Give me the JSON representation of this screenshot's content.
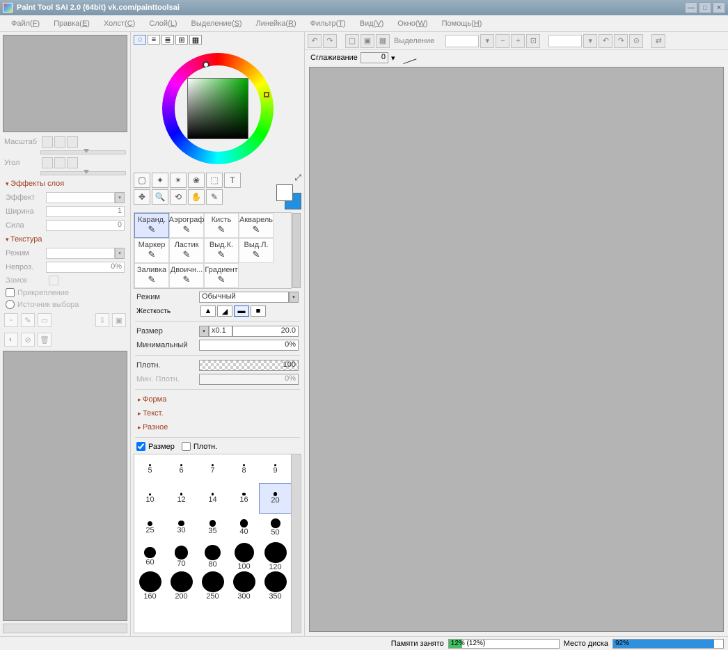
{
  "title": "Paint Tool SAI 2.0 (64bit) vk.com/painttoolsai",
  "menu": [
    "Файл(F)",
    "Правка(E)",
    "Холст(C)",
    "Слой(L)",
    "Выделение(S)",
    "Линейка(R)",
    "Фильтр(T)",
    "Вид(V)",
    "Окно(W)",
    "Помощь(H)"
  ],
  "nav": {
    "scale": "Масштаб",
    "angle": "Угол"
  },
  "layerfx": {
    "head": "Эффекты слоя",
    "effect_label": "Эффект",
    "width_label": "Ширина",
    "width_val": "1",
    "strength_label": "Сила",
    "strength_val": "0"
  },
  "texture": {
    "head": "Текстура",
    "mode_label": "Режим",
    "opacity_label": "Непроз.",
    "opacity_val": "0%",
    "lock_label": "Замок",
    "attach_label": "Прикрепление",
    "source_label": "Источник выбора"
  },
  "tools_icons": [
    "◌",
    "≡",
    "≣",
    "⊞",
    "▦"
  ],
  "sel_tools": [
    "▢",
    "✦",
    "✴",
    "❀",
    "⬚",
    "T",
    "✥",
    "🔍",
    "⟲",
    "✋",
    "✎"
  ],
  "brush_tools": [
    {
      "name": "Каранд.",
      "sel": true
    },
    {
      "name": "Аэрограф"
    },
    {
      "name": "Кисть"
    },
    {
      "name": "Акварель"
    },
    {
      "name": "Маркер"
    },
    {
      "name": "Ластик"
    },
    {
      "name": "Выд.К."
    },
    {
      "name": "Выд.Л."
    },
    {
      "name": "Заливка"
    },
    {
      "name": "Двоичн..."
    },
    {
      "name": "Градиент"
    }
  ],
  "brush": {
    "mode_label": "Режим",
    "mode_val": "Обычный",
    "hardness_label": "Жесткость",
    "size_label": "Размер",
    "size_mult": "x0.1",
    "size_val": "20.0",
    "min_label": "Минимальный",
    "min_val": "0%",
    "density_label": "Плотн.",
    "density_val": "100",
    "mindens_label": "Мин. Плотн.",
    "mindens_val": "0%",
    "shape_head": "Форма",
    "text_head": "Текст.",
    "misc_head": "Разное",
    "chk_size": "Размер",
    "chk_dens": "Плотн."
  },
  "sizes": [
    5,
    6,
    7,
    8,
    9,
    10,
    12,
    14,
    16,
    20,
    25,
    30,
    35,
    40,
    50,
    60,
    70,
    80,
    100,
    120,
    160,
    200,
    250,
    300,
    350
  ],
  "size_selected": 20,
  "ctoolbar": {
    "sel_label": "Выделение"
  },
  "smooth": {
    "label": "Сглаживание",
    "val": "0"
  },
  "status": {
    "mem_label": "Памяти занято",
    "mem_txt": "12% (12%)",
    "disk_label": "Место диска",
    "disk_txt": "92%"
  }
}
